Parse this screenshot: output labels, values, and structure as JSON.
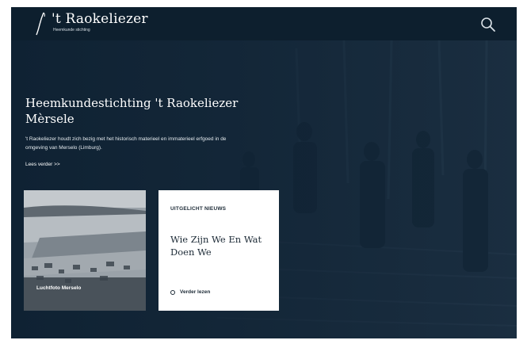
{
  "brand": {
    "name": "'t Raokeliezer",
    "subtitle": "Heemkunde stichting"
  },
  "header": {
    "search_icon": "search-icon"
  },
  "hero": {
    "title_line1": "Heemkundestichting 't Raokeliezer",
    "title_line2": "Mèrsele",
    "description": "'t Raokeliezer houdt zich bezig met het historisch materieel en immaterieel erfgoed in de omgeving van Merselo (Limburg).",
    "read_more": "Lees verder >>"
  },
  "cards": {
    "photo": {
      "caption": "Luchtfoto Merselo"
    },
    "news": {
      "kicker": "UITGELICHT NIEUWS",
      "title": "Wie Zijn We En Wat Doen We",
      "link": "Verder lezen"
    }
  },
  "colors": {
    "background": "#0f2233",
    "header": "#0d1f2e",
    "card": "#ffffff",
    "text_dark": "#1c2a36"
  }
}
